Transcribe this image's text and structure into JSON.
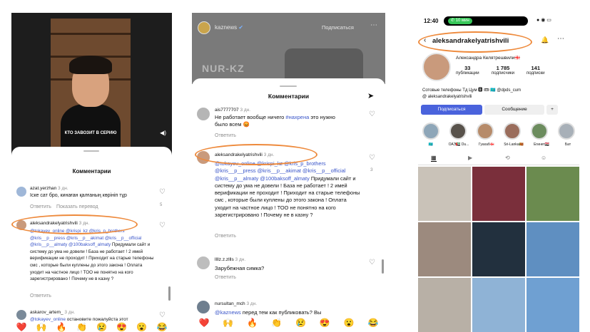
{
  "panel1": {
    "video_caption": "КТО ЗАВОЗИТ В СЕРИЮ",
    "sheet_title": "Комментарии",
    "comments": [
      {
        "user": "azat.yerzhan",
        "time": "3 дн.",
        "text": "Іске сат бро, кинаған қалғаның көрініп тұр",
        "reply": "Ответить",
        "see_translation": "Показать перевод",
        "likes": "5"
      },
      {
        "user": "aleksandrakelyatrishvili",
        "time": "3 дн.",
        "mentions": "@tokayev_online @krispi_kz @kris_p_brothers @kris__p__press @kris__p__akimat @kris__p__official @kris__p__almaty @100baksoff_almaty",
        "text": "Придумали сайт и систему до ума не довели ! База не работает ! 2 имей верификации не проходит ! Приходит на старые телефоны смс , которые были куплены до этого закона ! Оплата уходит на частное лицо ! ТОО не понятно на кого зарегистрировано ! Почему не в казну ?",
        "reply": "Ответить"
      },
      {
        "user": "askarov_artem_",
        "time": "3 дн.",
        "mention": "@tokayev_online",
        "text": "остановите пожалуйста этот"
      }
    ],
    "emojis": [
      "❤️",
      "🙌",
      "🔥",
      "👏",
      "😢",
      "😍",
      "😮",
      "😂"
    ]
  },
  "panel2": {
    "account": "kaznews",
    "follow": "Подписаться",
    "banner_text": "NUR-KZ",
    "sheet_title": "Комментарии",
    "comments": [
      {
        "user": "ais7777707",
        "time": "3 дн.",
        "text_a": "Не работает вообще ничего",
        "hashtag": "#нахрена",
        "text_b": "это нужно было всем 😡",
        "reply": "Ответить"
      },
      {
        "user": "aleksandrakelyatrishvili",
        "time": "3 дн.",
        "mentions": "@tokayev_online @krispi_kz @kris_p_brothers @kris__p__press @kris__p__akimat @kris__p__official @kris__p__almaty @100baksoff_almaty",
        "text": "Придумали сайт и систему до ума не довели ! База не работает ! 2 имей верификации не проходит ! Приходит на старые телефоны смс , которые были куплены до этого закона ! Оплата уходит на частное лицо ! ТОО не понятно на кого зарегистрировано ! Почему не в казну ?",
        "reply": "Ответить",
        "likes": "3"
      },
      {
        "user": "llllz.z.zllls",
        "time": "3 дн.",
        "text": "Зарубежная симка?",
        "reply": "Ответить"
      },
      {
        "user": "nursultan_mch",
        "time": "3 дн.",
        "mention": "@kaznews",
        "text": "перед тем как публиковать? Вы"
      }
    ],
    "emojis": [
      "❤️",
      "🙌",
      "🔥",
      "👏",
      "😢",
      "😍",
      "😮",
      "😂"
    ]
  },
  "panel3": {
    "status_time": "12:40",
    "call_pill": "10 мин",
    "username": "aleksandrakelyatrishvili",
    "display_name": "Александра Келятрешвили🇬🇪",
    "stats": [
      {
        "value": "33",
        "label": "публикации"
      },
      {
        "value": "1 785",
        "label": "подписчики"
      },
      {
        "value": "141",
        "label": "подписки"
      }
    ],
    "bio": "Сотовые телефоны Тд Цум 🅱 🎟 🇰🇿 @dpds_cum",
    "threads_handle": "aleksandrakelyatrishvili",
    "follow_button": "Подписаться",
    "message_button": "Сообщение",
    "highlights": [
      "🇰🇿",
      "ОАЭ🇦🇪 Du...",
      "Гуахаб🇬🇪",
      "Sri-Lanka🇱🇰",
      "Егинет🇪🇬",
      "Бат"
    ]
  },
  "colors": {
    "accent": "#3a55c9",
    "highlight_oval": "#ee8a3c",
    "follow_blue": "#4a63dc",
    "call_green": "#37c759"
  }
}
